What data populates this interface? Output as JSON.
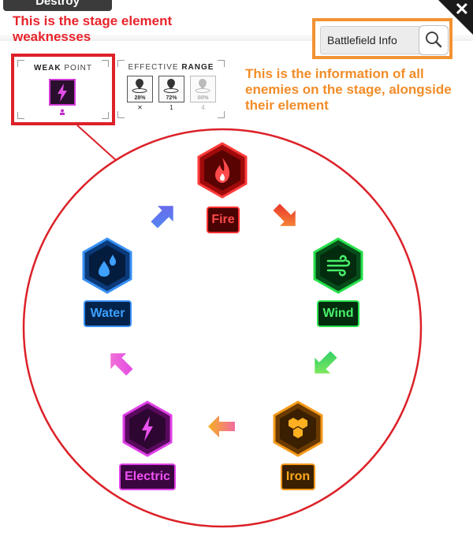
{
  "top_button": {
    "label": "Destroy"
  },
  "annotations": {
    "weakness_note": "This is the stage element weaknesses",
    "battlefield_note": "This is the information of all enemies on the stage, alongside their element"
  },
  "battlefield": {
    "label": "Battlefield Info",
    "search_icon": "magnifier-icon"
  },
  "weak_point": {
    "title_a": "WEAK",
    "title_b": "POINT",
    "element_icon": "lightning-icon"
  },
  "effective_range": {
    "title_a": "EFFECTIVE",
    "title_b": "RANGE",
    "cells": [
      {
        "pct": "28%",
        "mark": "✕"
      },
      {
        "pct": "72%",
        "mark": "1"
      },
      {
        "pct": "00%",
        "mark": "4"
      }
    ]
  },
  "elements": {
    "fire": {
      "label": "Fire",
      "icon": "flame-icon",
      "color": "#e02020"
    },
    "wind": {
      "label": "Wind",
      "icon": "wind-icon",
      "color": "#20c040"
    },
    "iron": {
      "label": "Iron",
      "icon": "hexagons-icon",
      "color": "#f0920c"
    },
    "electric": {
      "label": "Electric",
      "icon": "lightning-icon",
      "color": "#d23ad8"
    },
    "water": {
      "label": "Water",
      "icon": "droplets-icon",
      "color": "#2f8ff0"
    }
  },
  "close_icon": "close-icon"
}
